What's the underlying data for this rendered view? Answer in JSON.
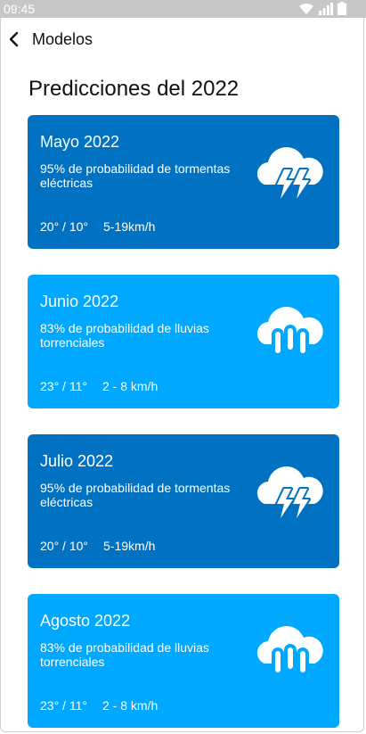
{
  "status_bar": {
    "time": "09:45"
  },
  "header": {
    "back_label": "Modelos"
  },
  "page": {
    "title": "Predicciones del 2022"
  },
  "colors": {
    "storm_card": "#0072c1",
    "rain_card": "#00a8ff"
  },
  "cards": [
    {
      "month": "Mayo 2022",
      "description": "95% de probabilidad de tormentas eléctricas",
      "temperature": "20° / 10°",
      "wind": "5-19km/h",
      "icon": "storm-cloud-icon"
    },
    {
      "month": "Junio 2022",
      "description": "83% de probabilidad de lluvias torrenciales",
      "temperature": "23° / 11°",
      "wind": "2 - 8 km/h",
      "icon": "rain-cloud-icon"
    },
    {
      "month": "Julio 2022",
      "description": "95% de probabilidad de tormentas eléctricas",
      "temperature": "20° / 10°",
      "wind": "5-19km/h",
      "icon": "storm-cloud-icon"
    },
    {
      "month": "Agosto 2022",
      "description": "83% de probabilidad de lluvias torrenciales",
      "temperature": "23° / 11°",
      "wind": "2 - 8 km/h",
      "icon": "rain-cloud-icon"
    }
  ]
}
